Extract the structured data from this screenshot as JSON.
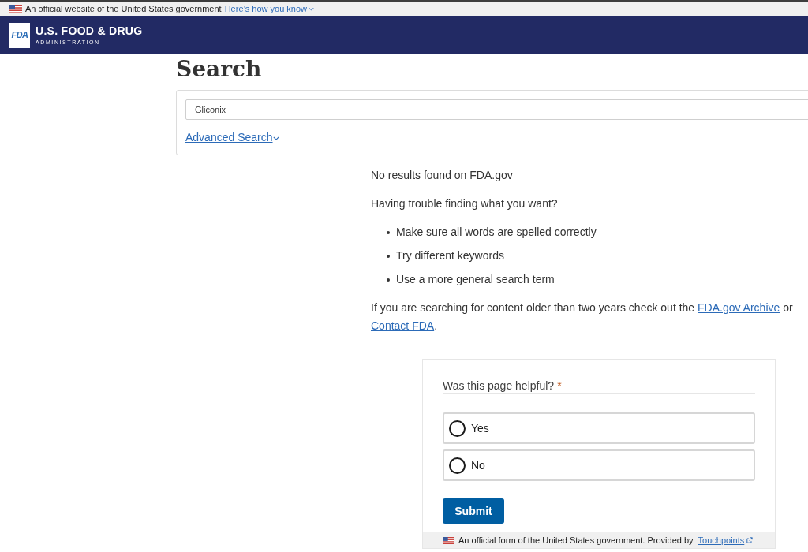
{
  "gov_banner": {
    "text": "An official website of the United States government",
    "link": "Here’s how you know"
  },
  "header": {
    "logo": "FDA",
    "title": "U.S. FOOD & DRUG",
    "subtitle": "ADMINISTRATION"
  },
  "page_title": "Search",
  "search": {
    "value": "Gliconix",
    "advanced_link": "Advanced Search"
  },
  "results": {
    "message": "No results found on FDA.gov",
    "help_heading": "Having trouble finding what you want?",
    "tips": [
      "Make sure all words are spelled correctly",
      "Try different keywords",
      "Use a more general search term"
    ],
    "archive_note": {
      "text": "If you are searching for content older than two years check out the",
      "archive_link": "FDA.gov Archive",
      "conjunction": "or",
      "contact_link": "Contact FDA",
      "end": "."
    }
  },
  "feedback": {
    "question": "Was this page helpful?",
    "required_mark": "*",
    "options": [
      {
        "label": "Yes",
        "selected": false
      },
      {
        "label": "No",
        "selected": false
      }
    ],
    "submit": "Submit",
    "footer": {
      "text": "An official form of the United States government. Provided by",
      "link": "Touchpoints"
    }
  }
}
